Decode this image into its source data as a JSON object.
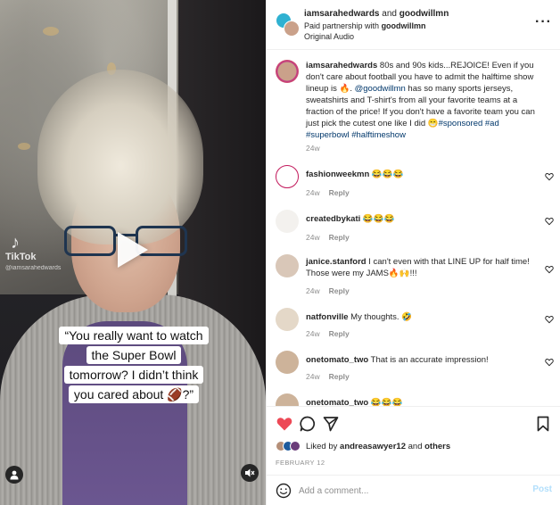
{
  "header": {
    "user1": "iamsarahedwards",
    "and": "and",
    "user2": "goodwillmn",
    "partnership_prefix": "Paid partnership with",
    "partner": "goodwillmn",
    "audio": "Original Audio",
    "more_icon": "more-horizontal-icon"
  },
  "video": {
    "watermark_brand": "TikTok",
    "watermark_handle": "@iamsarahedwards",
    "caption_lines": [
      "“You really want to watch",
      "the Super Bowl",
      "tomorrow? I didn’t think",
      "you cared about 🏈?”"
    ],
    "play_icon": "play-icon",
    "user_icon": "user-icon",
    "mute_icon": "mute-icon"
  },
  "post_caption": {
    "username": "iamsarahedwards",
    "text_a": " 80s and 90s kids...REJOICE! Even if you don't care about football you have to admit the halftime show lineup is 🔥. ",
    "mention": "@goodwillmn",
    "text_b": " has so many sports jerseys, sweatshirts and T-shirt's from all your favorite teams at a fraction of the price! If you don't have a favorite team you can just pick the cutest one like I did 😁",
    "hashtags_1": "#sponsored #ad",
    "hashtags_2": "#superbowl #halftimeshow",
    "time": "24w"
  },
  "comments": [
    {
      "username": "fashionweekmn",
      "text": " 😂😂😂",
      "time": "24w",
      "reply": "Reply"
    },
    {
      "username": "createdbykati",
      "text": " 😂😂😂",
      "time": "24w",
      "reply": "Reply"
    },
    {
      "username": "janice.stanford",
      "text": " I can't even with that LINE UP for half time! Those were my JAMS🔥🙌!!!",
      "time": "24w",
      "reply": "Reply"
    },
    {
      "username": "natfonville",
      "text": " My thoughts. 🤣",
      "time": "24w",
      "reply": "Reply"
    },
    {
      "username": "onetomato_two",
      "text": " That is an accurate impression!",
      "time": "24w",
      "reply": "Reply"
    },
    {
      "username": "onetomato_two",
      "text": " 😂😂😂",
      "time": "",
      "reply": ""
    }
  ],
  "actions": {
    "like_icon": "heart-icon",
    "comment_icon": "comment-icon",
    "share_icon": "send-icon",
    "save_icon": "bookmark-icon"
  },
  "likes": {
    "prefix": "Liked by",
    "user": "andreasawyer12",
    "middle": "and",
    "others": "others"
  },
  "date": "FEBRUARY 12",
  "add_comment": {
    "placeholder": "Add a comment...",
    "post_label": "Post",
    "emoji_icon": "smile-icon"
  },
  "colors": {
    "like_red": "#ed4956",
    "link_blue": "#00376b",
    "muted_gray": "#8e8e8e",
    "post_blue": "#b2dffc"
  }
}
